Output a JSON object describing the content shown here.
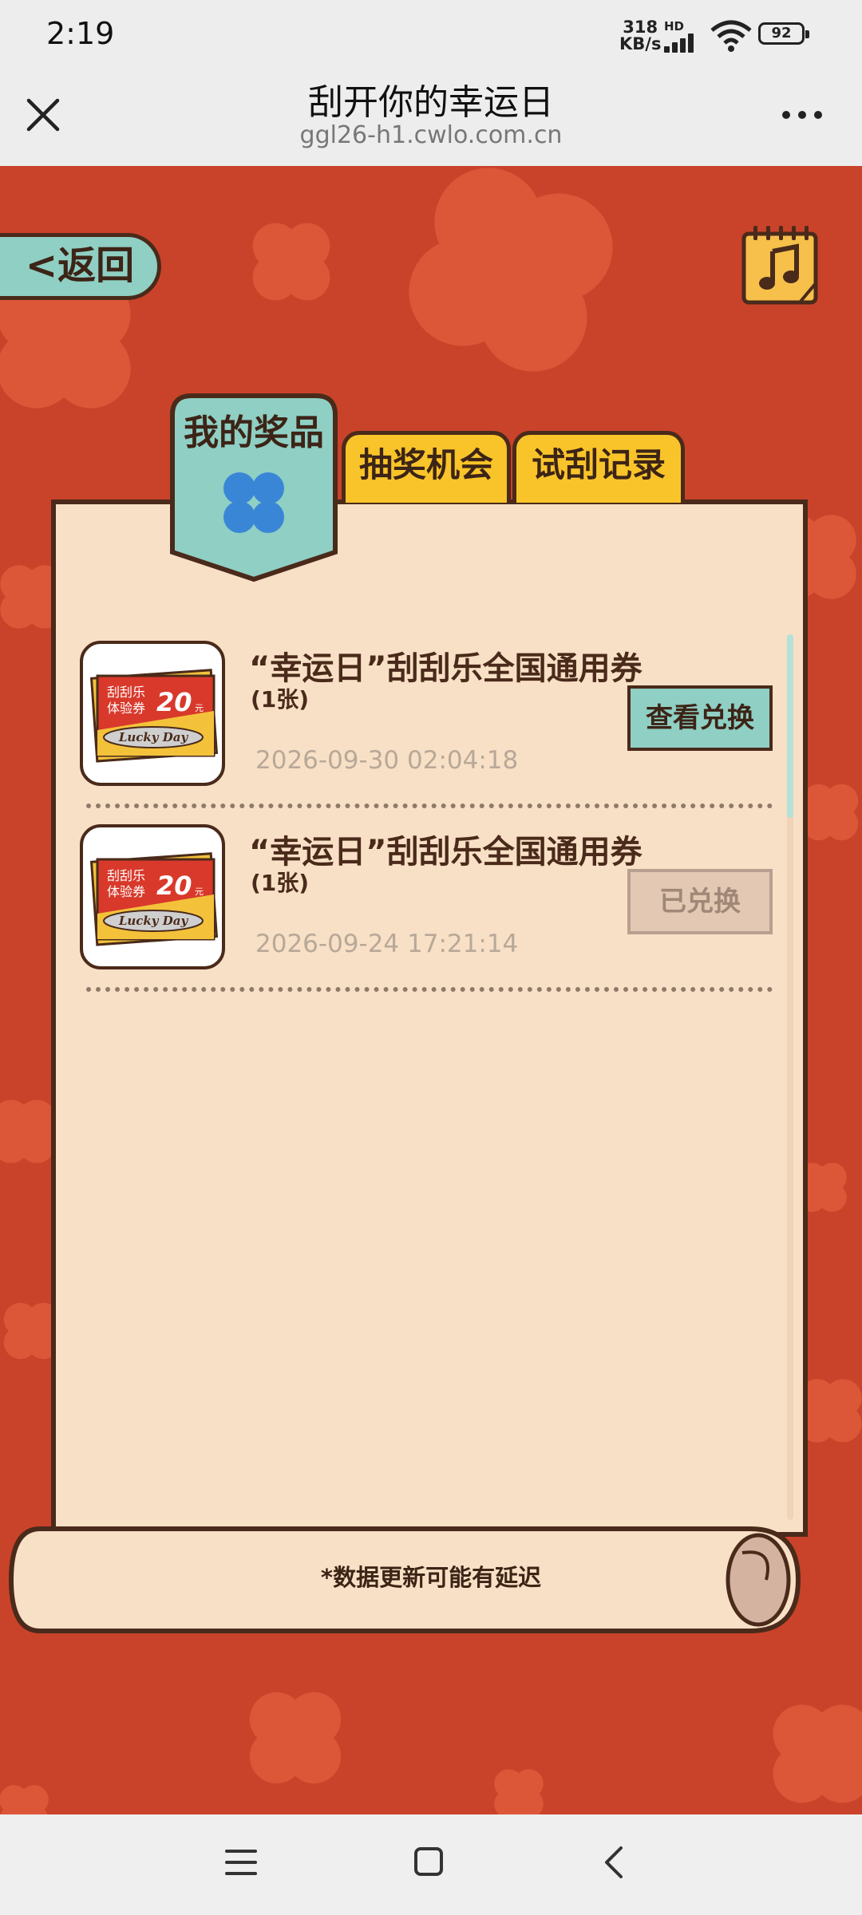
{
  "status_bar": {
    "time": "2:19",
    "speed_value": "318",
    "speed_unit": "KB/s",
    "network_badge": "HD",
    "battery": "92"
  },
  "title_bar": {
    "title": "刮开你的幸运日",
    "url": "ggl26-h1.cwlo.com.cn",
    "close_icon": "close-icon",
    "more_icon": "more-icon"
  },
  "game": {
    "back_label": "<返回",
    "music_icon": "music-note-icon",
    "tabs": [
      {
        "label": "我的奖品",
        "active": true
      },
      {
        "label": "抽奖机会",
        "active": false
      },
      {
        "label": "试刮记录",
        "active": false
      }
    ],
    "prizes": [
      {
        "name": "“幸运日”刮刮乐全国通用券",
        "qty": "(1张)",
        "date": "2026-09-30 02:04:18",
        "button": "查看兑换",
        "redeemed": false
      },
      {
        "name": "“幸运日”刮刮乐全国通用券",
        "qty": "(1张)",
        "date": "2026-09-24 17:21:14",
        "button": "已兑换",
        "redeemed": true
      }
    ],
    "coupon_art": {
      "line1": "刮刮乐",
      "line2": "体验券",
      "value": "20",
      "unit": "元",
      "banner": "Lucky Day"
    },
    "footnote": "*数据更新可能有延迟"
  },
  "colors": {
    "background": "#c9432a",
    "paper": "#f8e0c6",
    "teal": "#8fcfc4",
    "yellow": "#f9c42a",
    "outline": "#4a2a1a"
  },
  "nav_bar": {
    "menu_icon": "menu-icon",
    "home_icon": "home-icon",
    "back_icon": "back-icon"
  }
}
